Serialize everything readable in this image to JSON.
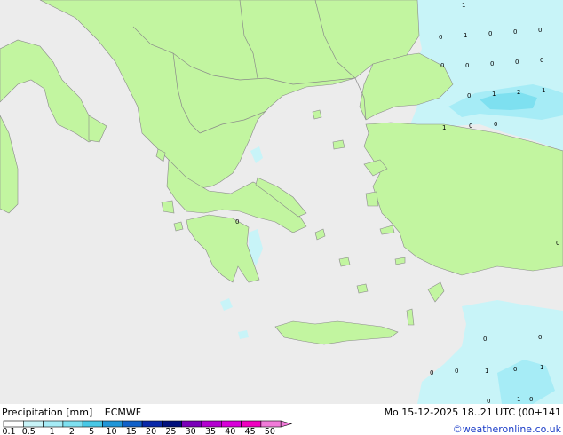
{
  "title": {
    "left": "Precipitation [mm]",
    "model": "ECMWF",
    "datetime": "Mo 15-12-2025 18..21 UTC (00+141"
  },
  "credit": "©weatheronline.co.uk",
  "legend": {
    "ticks": [
      "0.1",
      "0.5",
      "1",
      "2",
      "5",
      "10",
      "15",
      "20",
      "25",
      "30",
      "35",
      "40",
      "45",
      "50"
    ],
    "colors": [
      "#ffffff",
      "#c8f4f8",
      "#a6ecf6",
      "#7ee0f0",
      "#48c8e6",
      "#2096d8",
      "#1060c8",
      "#0828a8",
      "#00107c",
      "#7a00b8",
      "#b400d0",
      "#d800d8",
      "#f000c0",
      "#f07ad8"
    ]
  },
  "colors": {
    "sea": "#ececec",
    "land": "#c2f5a0",
    "border": "#8a8a8a",
    "precip_light": "#c8f4f8",
    "precip_mid": "#a6ecf6",
    "precip_strong": "#7ee0f0"
  },
  "point_values": [
    {
      "label": "1"
    },
    {
      "label": "0"
    },
    {
      "label": "1"
    },
    {
      "label": "0"
    },
    {
      "label": "0"
    },
    {
      "label": "0"
    },
    {
      "label": "0"
    },
    {
      "label": "0"
    },
    {
      "label": "0"
    },
    {
      "label": "0"
    },
    {
      "label": "0"
    },
    {
      "label": "0"
    },
    {
      "label": "1"
    },
    {
      "label": "2"
    },
    {
      "label": "1"
    },
    {
      "label": "1"
    },
    {
      "label": "0"
    },
    {
      "label": "0"
    },
    {
      "label": "0"
    },
    {
      "label": "0"
    },
    {
      "label": "0"
    },
    {
      "label": "0"
    },
    {
      "label": "0"
    },
    {
      "label": "1"
    },
    {
      "label": "0"
    },
    {
      "label": "1"
    },
    {
      "label": "0"
    },
    {
      "label": "0"
    },
    {
      "label": "0"
    },
    {
      "label": "1"
    }
  ]
}
